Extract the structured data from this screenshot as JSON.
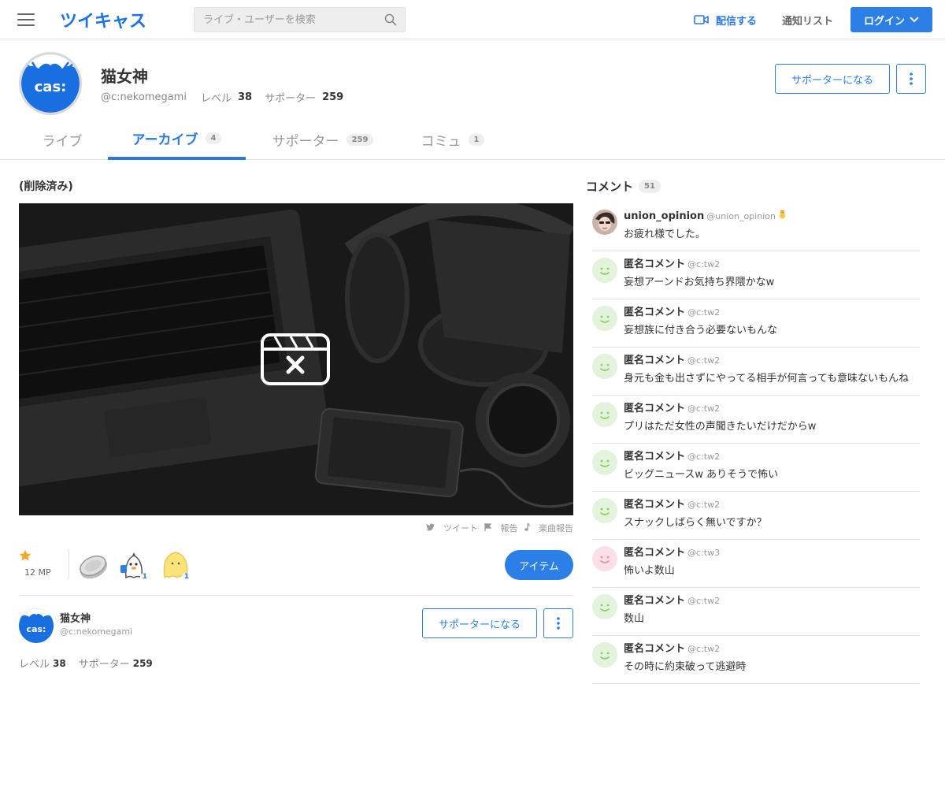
{
  "header": {
    "logo": "ツイキャス",
    "search_placeholder": "ライブ・ユーザーを検索",
    "broadcast_label": "配信する",
    "notify_label": "通知リスト",
    "login_label": "ログイン"
  },
  "profile": {
    "avatar_text": "cas:",
    "name": "猫女神",
    "handle": "@c:nekomegami",
    "level_label": "レベル",
    "level": "38",
    "supporter_label": "サポーター",
    "supporters": "259",
    "supporter_button": "サポーターになる"
  },
  "tabs": [
    {
      "label": "ライブ",
      "count": ""
    },
    {
      "label": "アーカイブ",
      "count": "4"
    },
    {
      "label": "サポーター",
      "count": "259"
    },
    {
      "label": "コミュ",
      "count": "1"
    }
  ],
  "video": {
    "title": "(削除済み)",
    "tweet_label": "ツイート",
    "report_label": "報告",
    "music_report_label": "楽曲報告"
  },
  "items": {
    "mp_label": "12 MP",
    "gift_counts": [
      "",
      "1",
      "1"
    ],
    "item_button": "アイテム"
  },
  "owner": {
    "name": "猫女神",
    "handle": "@c:nekomegami",
    "supporter_button": "サポーターになる",
    "level_label": "レベル",
    "level": "38",
    "supporter_label": "サポーター",
    "supporters": "259"
  },
  "comments": {
    "title": "コメント",
    "count": "51",
    "list": [
      {
        "name": "union_opinion",
        "handle": "@union_opinion",
        "text": "お疲れ様でした。",
        "avatar": "photo"
      },
      {
        "name": "匿名コメント",
        "handle": "@c:tw2",
        "text": "妄想アーンドお気持ち界隈かなw",
        "avatar": "green"
      },
      {
        "name": "匿名コメント",
        "handle": "@c:tw2",
        "text": "妄想族に付き合う必要ないもんな",
        "avatar": "green"
      },
      {
        "name": "匿名コメント",
        "handle": "@c:tw2",
        "text": "身元も金も出さずにやってる相手が何言っても意味ないもんね",
        "avatar": "green"
      },
      {
        "name": "匿名コメント",
        "handle": "@c:tw2",
        "text": "プリはただ女性の声聞きたいだけだからw",
        "avatar": "green"
      },
      {
        "name": "匿名コメント",
        "handle": "@c:tw2",
        "text": "ビッグニュースw ありそうで怖い",
        "avatar": "green"
      },
      {
        "name": "匿名コメント",
        "handle": "@c:tw2",
        "text": "スナックしばらく無いですか？",
        "avatar": "green"
      },
      {
        "name": "匿名コメント",
        "handle": "@c:tw3",
        "text": "怖いよ数山",
        "avatar": "pink"
      },
      {
        "name": "匿名コメント",
        "handle": "@c:tw2",
        "text": "数山",
        "avatar": "green"
      },
      {
        "name": "匿名コメント",
        "handle": "@c:tw2",
        "text": "その時に約束破って逃避時",
        "avatar": "green"
      }
    ]
  },
  "colors": {
    "accent": "#2b7fe6",
    "avatar_green": "#e3f3dc",
    "avatar_pink": "#fbe1e7"
  }
}
